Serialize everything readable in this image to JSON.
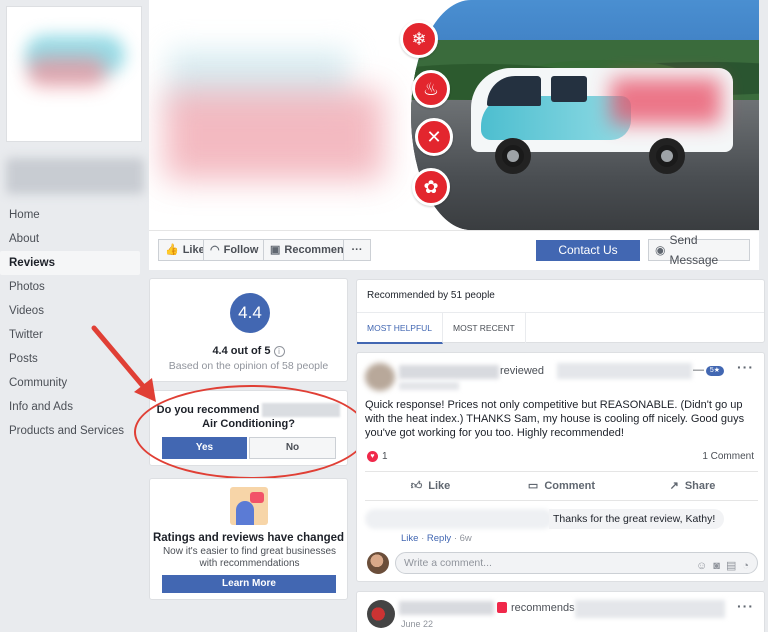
{
  "left_nav": {
    "items": [
      {
        "label": "Home"
      },
      {
        "label": "About"
      },
      {
        "label": "Reviews"
      },
      {
        "label": "Photos"
      },
      {
        "label": "Videos"
      },
      {
        "label": "Twitter"
      },
      {
        "label": "Posts"
      },
      {
        "label": "Community"
      },
      {
        "label": "Info and Ads"
      },
      {
        "label": "Products and Services"
      }
    ],
    "active": "Reviews"
  },
  "cover": {
    "icons": [
      "snowflake-icon",
      "flame-icon",
      "tools-icon",
      "fan-icon"
    ],
    "accent_color": "#e3262e"
  },
  "action_bar": {
    "like_label": "Like",
    "follow_label": "Follow",
    "recommend_label": "Recommend",
    "more_label": "···",
    "contact_label": "Contact Us",
    "message_label": "Send Message"
  },
  "rating": {
    "score": "4.4",
    "summary": "4.4 out of 5",
    "info_glyph": "i",
    "basis": "Based on the opinion of 58 people"
  },
  "recommend_prompt": {
    "question_prefix": "Do you recommend",
    "question_suffix": "Air Conditioning?",
    "yes_label": "Yes",
    "no_label": "No"
  },
  "changed_card": {
    "title": "Ratings and reviews have changed",
    "subtitle": "Now it's easier to find great businesses with recommendations",
    "button_label": "Learn More"
  },
  "reviews_header": {
    "recommended_by": "Recommended by 51 people",
    "tabs": [
      {
        "label": "MOST HELPFUL"
      },
      {
        "label": "MOST RECENT"
      }
    ],
    "active_tab": "MOST HELPFUL"
  },
  "review": {
    "action_word": "reviewed",
    "dash": "—",
    "badge": "5★",
    "more": "···",
    "text": "Quick response! Prices not only competitive but REASONABLE. (Didn't go up with the heat index.) THANKS Sam, my house is cooling off nicely. Good guys you've got working for you too. Highly recommended!",
    "reactions_count": "1",
    "comments_count": "1 Comment",
    "actions": {
      "like": "Like",
      "comment": "Comment",
      "share": "Share"
    },
    "reply": {
      "text": "Thanks for the great review, Kathy!",
      "like": "Like",
      "separator": " · ",
      "reply": "Reply",
      "age": " · 6w"
    },
    "comment_placeholder": "Write a comment..."
  },
  "next_post": {
    "action_word": "recommends",
    "date": "June 22",
    "more": "···"
  }
}
